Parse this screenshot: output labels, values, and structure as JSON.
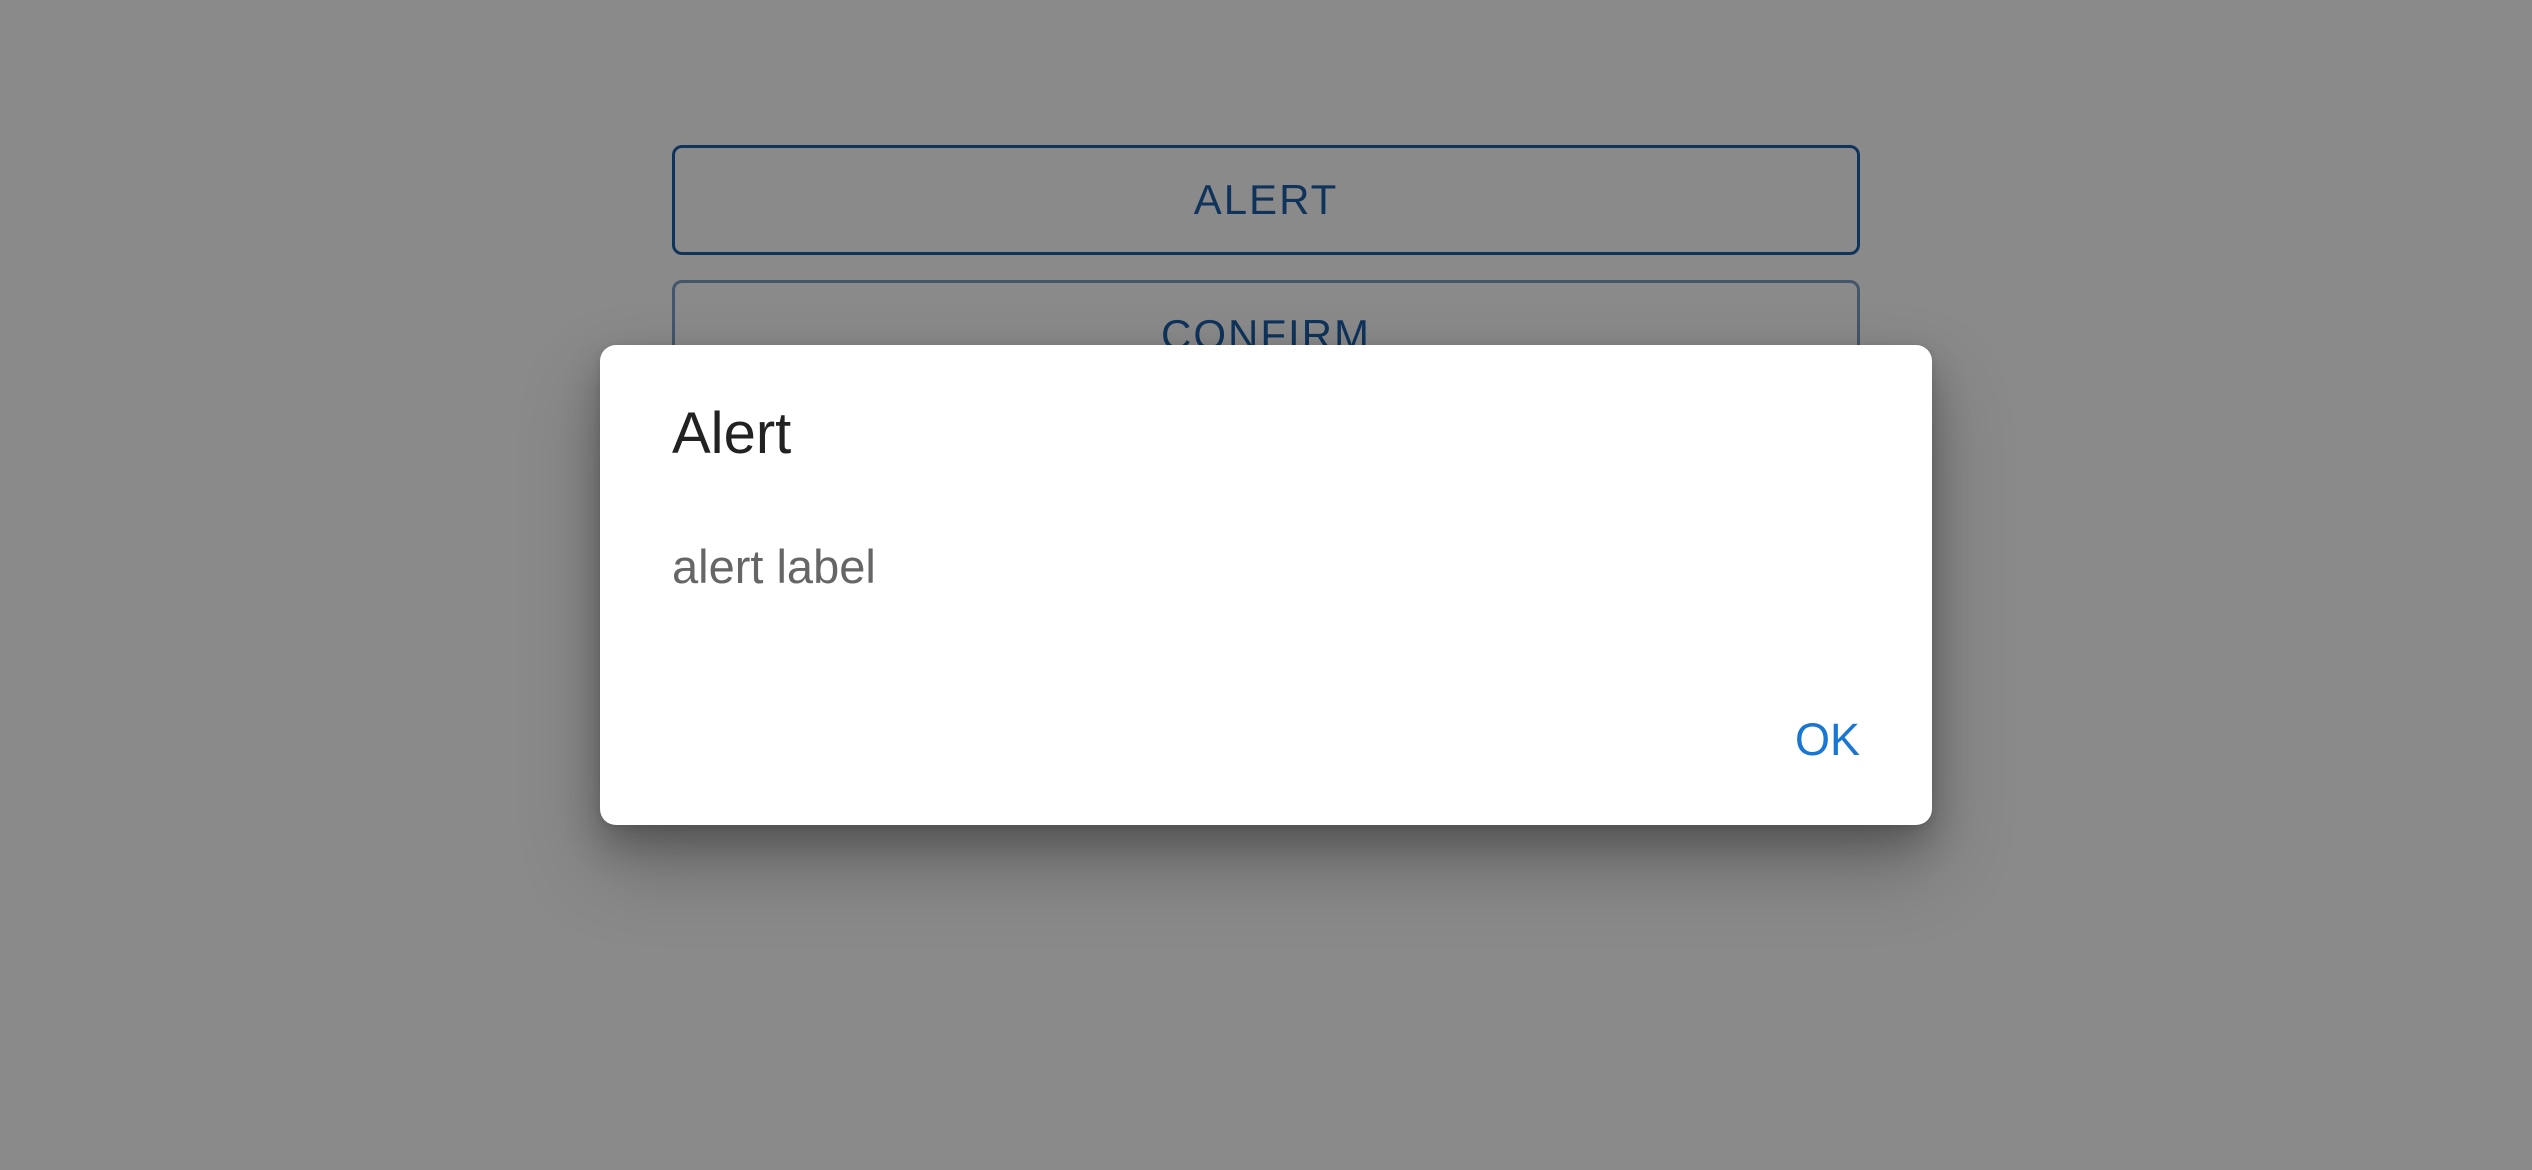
{
  "background": {
    "buttons": [
      {
        "label": "ALERT"
      },
      {
        "label": "CONFIRM"
      }
    ]
  },
  "dialog": {
    "title": "Alert",
    "message": "alert label",
    "actions": [
      {
        "label": "OK"
      }
    ]
  },
  "colors": {
    "scrim": "#8a8a8a",
    "dialog_background": "#ffffff",
    "primary": "#1976d2",
    "outlined_button": "#1d5ea8",
    "title_text": "#222222",
    "message_text": "#666666"
  }
}
